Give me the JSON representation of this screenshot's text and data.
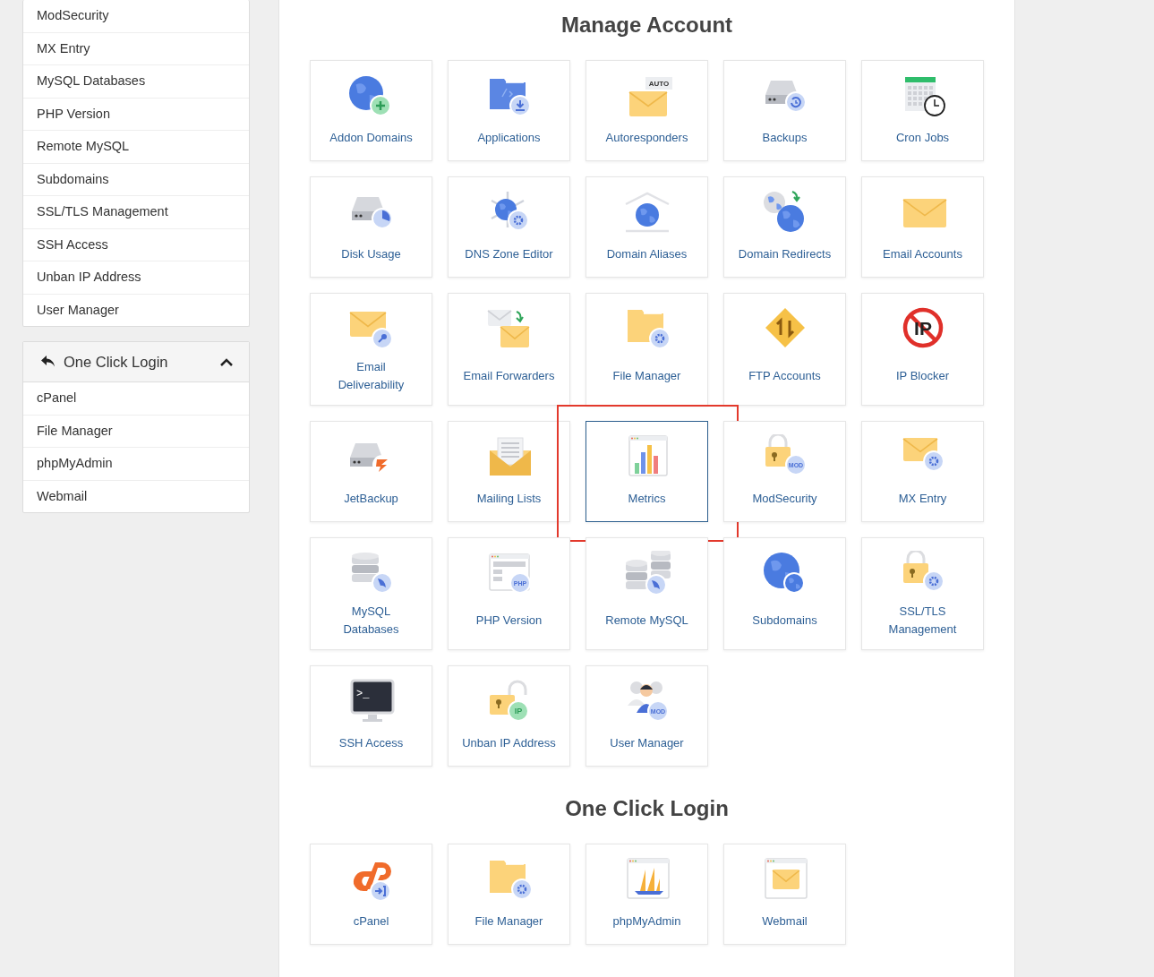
{
  "sidebar": {
    "tools_list": [
      {
        "label": "ModSecurity"
      },
      {
        "label": "MX Entry"
      },
      {
        "label": "MySQL Databases"
      },
      {
        "label": "PHP Version"
      },
      {
        "label": "Remote MySQL"
      },
      {
        "label": "Subdomains"
      },
      {
        "label": "SSL/TLS Management"
      },
      {
        "label": "SSH Access"
      },
      {
        "label": "Unban IP Address"
      },
      {
        "label": "User Manager"
      }
    ],
    "one_click_login": {
      "title": "One Click Login",
      "expanded": true,
      "items": [
        {
          "label": "cPanel"
        },
        {
          "label": "File Manager"
        },
        {
          "label": "phpMyAdmin"
        },
        {
          "label": "Webmail"
        }
      ]
    }
  },
  "manage_account": {
    "title": "Manage Account",
    "tiles": [
      {
        "label": "Addon Domains",
        "selected": false
      },
      {
        "label": "Applications",
        "selected": false
      },
      {
        "label": "Autoresponders",
        "selected": false,
        "icon_text": "AUTO"
      },
      {
        "label": "Backups",
        "selected": false
      },
      {
        "label": "Cron Jobs",
        "selected": false
      },
      {
        "label": "Disk Usage",
        "selected": false
      },
      {
        "label": "DNS Zone Editor",
        "selected": false
      },
      {
        "label": "Domain Aliases",
        "selected": false
      },
      {
        "label": "Domain Redirects",
        "selected": false
      },
      {
        "label": "Email Accounts",
        "selected": false
      },
      {
        "label": "Email\nDeliverability",
        "selected": false
      },
      {
        "label": "Email Forwarders",
        "selected": false
      },
      {
        "label": "File Manager",
        "selected": false
      },
      {
        "label": "FTP Accounts",
        "selected": false
      },
      {
        "label": "IP Blocker",
        "selected": false,
        "icon_text": "IP"
      },
      {
        "label": "JetBackup",
        "selected": false
      },
      {
        "label": "Mailing Lists",
        "selected": false
      },
      {
        "label": "Metrics",
        "selected": true
      },
      {
        "label": "ModSecurity",
        "selected": false,
        "icon_text": "MOD"
      },
      {
        "label": "MX Entry",
        "selected": false
      },
      {
        "label": "MySQL\nDatabases",
        "selected": false
      },
      {
        "label": "PHP Version",
        "selected": false,
        "icon_text": "PHP"
      },
      {
        "label": "Remote MySQL",
        "selected": false
      },
      {
        "label": "Subdomains",
        "selected": false
      },
      {
        "label": "SSL/TLS\nManagement",
        "selected": false
      },
      {
        "label": "SSH Access",
        "selected": false,
        "icon_text": ">_"
      },
      {
        "label": "Unban IP Address",
        "selected": false,
        "icon_text": "IP"
      },
      {
        "label": "User Manager",
        "selected": false,
        "icon_text": "MOD"
      }
    ]
  },
  "one_click_login": {
    "title": "One Click Login",
    "tiles": [
      {
        "label": "cPanel",
        "selected": false
      },
      {
        "label": "File Manager",
        "selected": false
      },
      {
        "label": "phpMyAdmin",
        "selected": false
      },
      {
        "label": "Webmail",
        "selected": false
      }
    ]
  }
}
